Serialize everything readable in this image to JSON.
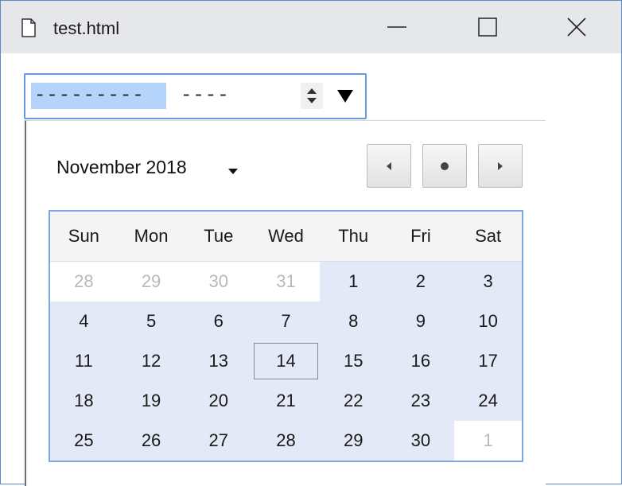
{
  "window": {
    "title": "test.html",
    "icons": {
      "doc": "document-icon",
      "min": "minimize-icon",
      "max": "maximize-icon",
      "close": "close-icon"
    }
  },
  "date_input": {
    "month_placeholder": "---------",
    "year_placeholder": "----",
    "selected_segment": "month",
    "accent_color": "#b5d4fb"
  },
  "calendar": {
    "month_label": "November 2018",
    "weekdays": [
      "Sun",
      "Mon",
      "Tue",
      "Wed",
      "Thu",
      "Fri",
      "Sat"
    ],
    "days": [
      {
        "d": "28",
        "o": true
      },
      {
        "d": "29",
        "o": true
      },
      {
        "d": "30",
        "o": true
      },
      {
        "d": "31",
        "o": true
      },
      {
        "d": "1",
        "o": false
      },
      {
        "d": "2",
        "o": false
      },
      {
        "d": "3",
        "o": false
      },
      {
        "d": "4",
        "o": false
      },
      {
        "d": "5",
        "o": false
      },
      {
        "d": "6",
        "o": false
      },
      {
        "d": "7",
        "o": false
      },
      {
        "d": "8",
        "o": false
      },
      {
        "d": "9",
        "o": false
      },
      {
        "d": "10",
        "o": false
      },
      {
        "d": "11",
        "o": false
      },
      {
        "d": "12",
        "o": false
      },
      {
        "d": "13",
        "o": false
      },
      {
        "d": "14",
        "o": false,
        "today": true
      },
      {
        "d": "15",
        "o": false
      },
      {
        "d": "16",
        "o": false
      },
      {
        "d": "17",
        "o": false
      },
      {
        "d": "18",
        "o": false
      },
      {
        "d": "19",
        "o": false
      },
      {
        "d": "20",
        "o": false
      },
      {
        "d": "21",
        "o": false
      },
      {
        "d": "22",
        "o": false
      },
      {
        "d": "23",
        "o": false
      },
      {
        "d": "24",
        "o": false
      },
      {
        "d": "25",
        "o": false
      },
      {
        "d": "26",
        "o": false
      },
      {
        "d": "27",
        "o": false
      },
      {
        "d": "28",
        "o": false
      },
      {
        "d": "29",
        "o": false
      },
      {
        "d": "30",
        "o": false
      },
      {
        "d": "1",
        "o": true
      }
    ],
    "colors": {
      "in_month_bg": "#e3e9f6",
      "other_month_text": "#b9b9b9",
      "border": "#7ea6e0"
    }
  }
}
